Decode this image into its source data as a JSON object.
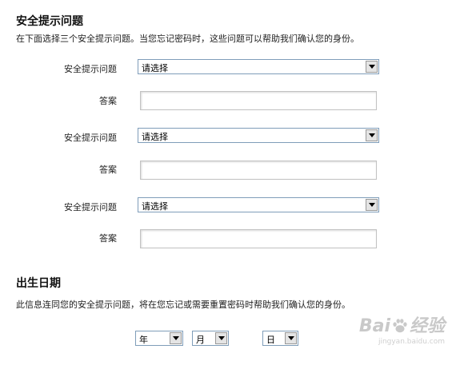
{
  "security_section": {
    "title": "安全提示问题",
    "description": "在下面选择三个安全提示问题。当您忘记密码时，这些问题可以帮助我们确认您的身份。",
    "questions": [
      {
        "question_label": "安全提示问题",
        "select_value": "请选择",
        "answer_label": "答案",
        "answer_value": ""
      },
      {
        "question_label": "安全提示问题",
        "select_value": "请选择",
        "answer_label": "答案",
        "answer_value": ""
      },
      {
        "question_label": "安全提示问题",
        "select_value": "请选择",
        "answer_label": "答案",
        "answer_value": ""
      }
    ]
  },
  "birth_section": {
    "title": "出生日期",
    "description": "此信息连同您的安全提示问题，将在您忘记或需要重置密码时帮助我们确认您的身份。",
    "year_value": "年",
    "month_value": "月",
    "day_value": "日"
  },
  "watermark": {
    "brand_left": "Bai",
    "brand_right": "经验",
    "url": "jingyan.baidu.com"
  }
}
